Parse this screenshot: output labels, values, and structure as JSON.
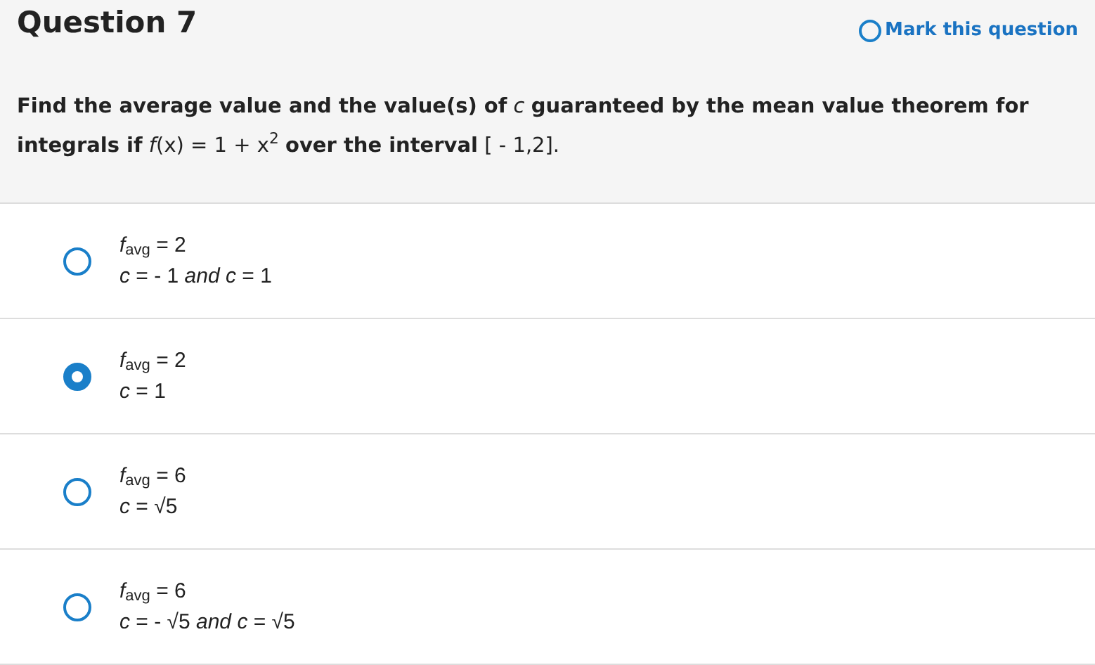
{
  "question": {
    "title": "Question 7",
    "mark": {
      "label": "Mark this question",
      "checked": false
    },
    "prompt": "**Find the average value and the value(s) of** *c* **guaranteed by the mean value theorem for integrals if** *f*(x) = 1 + x$^{2}$ **over the interval** [ - 1,2]."
  },
  "options": [
    {
      "selected": false,
      "line_1": "*f*$_{avg}$ = 2",
      "line_2": "*c* = - 1 *and* *c* = 1"
    },
    {
      "selected": true,
      "line_1": "*f*$_{avg}$ = 2",
      "line_2": "*c* = 1"
    },
    {
      "selected": false,
      "line_1": "*f*$_{avg}$ = 6",
      "line_2": "*c* = √5"
    },
    {
      "selected": false,
      "line_1": "*f*$_{avg}$ = 6",
      "line_2": "*c* = - √5 *and* *c* = √5"
    }
  ]
}
